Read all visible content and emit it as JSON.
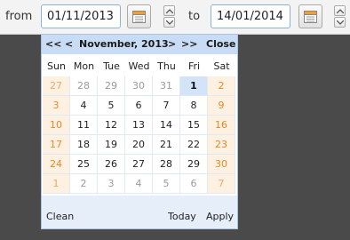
{
  "range": {
    "from_label": "from",
    "from_value": "01/11/2013",
    "to_label": "to",
    "to_value": "14/01/2014"
  },
  "icons": {
    "calendar": "calendar-icon",
    "spin_up": "chevron-up-icon",
    "spin_down": "chevron-down-icon"
  },
  "datepicker": {
    "nav_prev_year": "<<",
    "nav_prev_month": "<",
    "month_title": "November, 2013",
    "nav_next_month": ">",
    "nav_next_year": ">>",
    "close_label": "Close",
    "weekdays": [
      "Sun",
      "Mon",
      "Tue",
      "Wed",
      "Thu",
      "Fri",
      "Sat"
    ],
    "weeks": [
      [
        "27",
        "28",
        "29",
        "30",
        "31",
        "1",
        "2"
      ],
      [
        "3",
        "4",
        "5",
        "6",
        "7",
        "8",
        "9"
      ],
      [
        "10",
        "11",
        "12",
        "13",
        "14",
        "15",
        "16"
      ],
      [
        "17",
        "18",
        "19",
        "20",
        "21",
        "22",
        "23"
      ],
      [
        "24",
        "25",
        "26",
        "27",
        "28",
        "29",
        "30"
      ],
      [
        "1",
        "2",
        "3",
        "4",
        "5",
        "6",
        "7"
      ]
    ],
    "selected_day": "1",
    "clean_label": "Clean",
    "today_label": "Today",
    "apply_label": "Apply"
  },
  "colors": {
    "weekend_text": "#e4892c",
    "weekend_bg": "#fff1e1",
    "header_bg": "#c9dcf5",
    "selected_bg": "#d3e3f8",
    "footer_bg": "#e6eff9"
  }
}
